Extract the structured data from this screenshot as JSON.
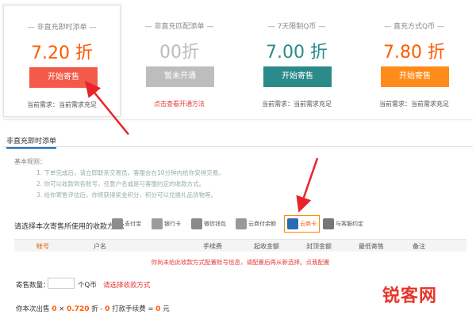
{
  "cards": [
    {
      "title": "— 非直充即时添单 —",
      "price": "7.20 折",
      "button": "开始寄售",
      "note": "当前需求：当前需求充足"
    },
    {
      "title": "— 非直充匹配添单 —",
      "price": "00折",
      "button": "暂未开通",
      "note": "点击查看开通方法"
    },
    {
      "title": "— 7天限制Q币 —",
      "price": "7.00 折",
      "button": "开始寄售",
      "note": "当前需求：当前需求充足"
    },
    {
      "title": "— 直充方式Q币 —",
      "price": "7.80 折",
      "button": "开始寄售",
      "note": "当前需求：当前需求充足"
    }
  ],
  "tab": "非直充即时添单",
  "rules": {
    "heading": "基本规则：",
    "items": [
      "1. 下单完成后，请立即联系交易员，客服会在10分钟内给你安排交易。",
      "2. 你可以收款到各账号，任意户名或是与客服约定的收款方式。",
      "3. 给你寄售评估后，你将获得奖金积分，积分可以兑换礼品货物等。"
    ]
  },
  "payment": {
    "label": "请选择本次寄售所使用的收款方式：",
    "options": [
      "支付宝",
      "银行卡",
      "微信钱包",
      "云商付余额",
      "云商卡",
      "与客服约定"
    ]
  },
  "table": {
    "headers": [
      "帐号",
      "户名",
      "手续费",
      "起收金额",
      "封顶金额",
      "最低寄售",
      "备注"
    ]
  },
  "warning": "你尚未给此收款方式配置账号信息，请配置后再从新选择。点我配置",
  "quantity": {
    "label": "寄售数量：",
    "unit": "个Q币",
    "link": "请选择收款方式"
  },
  "calc": {
    "prefix": "你本次出售",
    "a": "0",
    "x": "×",
    "rate": "0.720",
    "r_unit": "折 -",
    "fee": "0",
    "fee_label": "打款手续费 =",
    "total": "0",
    "unit": "元"
  },
  "watermark": "锐客网",
  "colors": {
    "orange_red": "#f45a4a",
    "gray": "#bdbdbd",
    "teal": "#2b8a8a",
    "orange": "#ff8c1a"
  }
}
